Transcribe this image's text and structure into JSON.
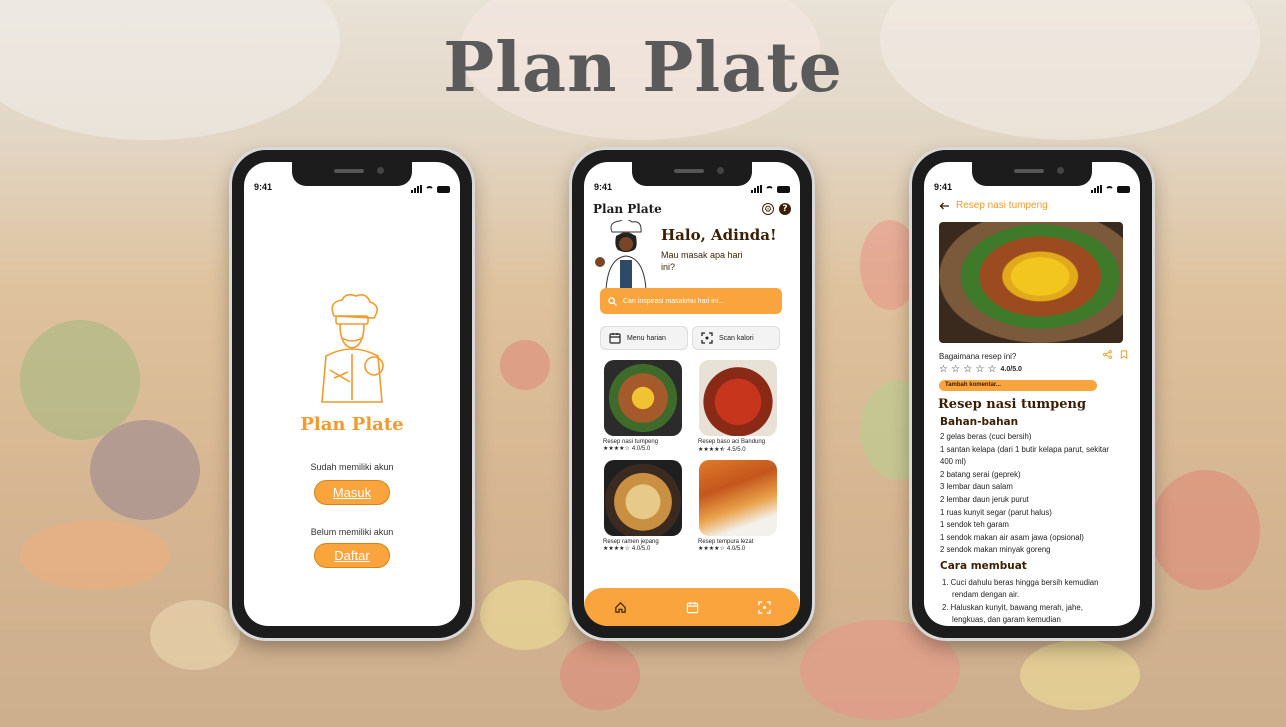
{
  "title": "Plan Plate",
  "colors": {
    "accent": "#f9a43c",
    "brand_text": "#f29a2e",
    "dark_brown": "#3a1f05",
    "title_gray": "#5a5a5a"
  },
  "status_time": "9:41",
  "screen_login": {
    "brand": "Plan Plate",
    "have_account_text": "Sudah memiliki akun",
    "login_button": "Masuk",
    "no_account_text": "Belum memiliki akun",
    "register_button": "Daftar"
  },
  "screen_home": {
    "logo": "Plan Plate",
    "icons": [
      "settings-icon",
      "help-icon"
    ],
    "greeting": "Halo, Adinda!",
    "subtitle": "Mau masak apa hari ini?",
    "search_placeholder": "Cari inspirasi masakmu hari ini...",
    "quick_actions": [
      {
        "label": "Menu harian",
        "icon": "calendar-icon"
      },
      {
        "label": "Scan kalori",
        "icon": "scan-icon"
      }
    ],
    "recipes": [
      {
        "name": "Resep nasi tumpeng",
        "rating": "4.0/5.0",
        "stars": 4
      },
      {
        "name": "Resep baso aci Bandung",
        "rating": "4.5/5.0",
        "stars": 4.5
      },
      {
        "name": "Resep ramen jepang",
        "rating": "4.0/5.0",
        "stars": 4
      },
      {
        "name": "Resep tempura lezat",
        "rating": "4.0/5.0",
        "stars": 4
      }
    ],
    "nav": [
      "home-icon",
      "calendar-icon",
      "scan-icon"
    ]
  },
  "screen_recipe": {
    "back_title": "Resep nasi tumpeng",
    "question": "Bagaimana resep ini?",
    "rating": "4.0/5.0",
    "comment_button": "Tambah komentar...",
    "title": "Resep nasi tumpeng",
    "ingredients_heading": "Bahan-bahan",
    "ingredients": [
      "2 gelas beras (cuci bersih)",
      "1 santan kelapa (dari 1 butir kelapa parut, sekitar 400 ml)",
      "2 batang serai (geprek)",
      "3 lembar daun salam",
      "2 lembar daun jeruk purut",
      "1 ruas kunyit segar (parut halus)",
      "1 sendok teh garam",
      "1 sendok makan air asam jawa (opsional)",
      "2 sendok makan minyak goreng"
    ],
    "steps_heading": "Cara membuat",
    "steps": [
      "1. Cuci dahulu beras hingga bersih kemudian rendam dengan air.",
      "2. Haluskan kunyit, bawang merah, jahe, lengkuas, dan garam kemudian"
    ]
  }
}
